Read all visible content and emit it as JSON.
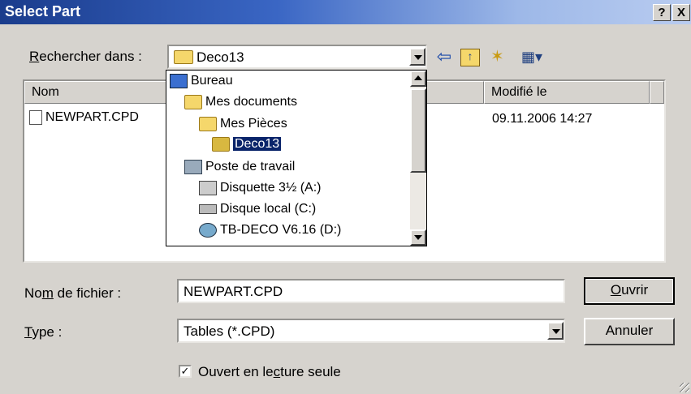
{
  "window": {
    "title": "Select Part",
    "help_label": "?",
    "close_label": "X"
  },
  "lookin": {
    "label_accel": "R",
    "label_rest": "echercher dans :",
    "value": "Deco13"
  },
  "toolbar": {
    "back_glyph": "⇦",
    "up_glyph": "↑",
    "newfolder_glyph": "✶",
    "view_glyph": "▦▾"
  },
  "filelist": {
    "columns": [
      "Nom",
      "Modifié le"
    ],
    "rows": [
      {
        "name": "NEWPART.CPD",
        "modified": "09.11.2006 14:27"
      }
    ]
  },
  "tree": {
    "items": [
      {
        "label": "Bureau",
        "icon": "desktop-icon"
      },
      {
        "label": "Mes documents",
        "icon": "my-documents-icon"
      },
      {
        "label": "Mes Pièces",
        "icon": "folder-icon"
      },
      {
        "label": "Deco13",
        "icon": "open-folder-icon"
      },
      {
        "label": "Poste de travail",
        "icon": "my-computer-icon"
      },
      {
        "label": "Disquette 3½ (A:)",
        "icon": "floppy-icon"
      },
      {
        "label": "Disque local (C:)",
        "icon": "hard-drive-icon"
      },
      {
        "label": "TB-DECO V6.16 (D:)",
        "icon": "cd-drive-icon"
      }
    ]
  },
  "filename": {
    "label_pre": "No",
    "label_accel": "m",
    "label_post": " de fichier :",
    "value": "NEWPART.CPD"
  },
  "type": {
    "label_accel": "T",
    "label_rest": "ype :",
    "value": "Tables (*.CPD)"
  },
  "buttons": {
    "open_accel": "O",
    "open_rest": "uvrir",
    "cancel": "Annuler"
  },
  "readonly": {
    "checked_glyph": "✓",
    "label_pre": "Ouvert en le",
    "label_accel": "c",
    "label_post": "ture seule"
  }
}
